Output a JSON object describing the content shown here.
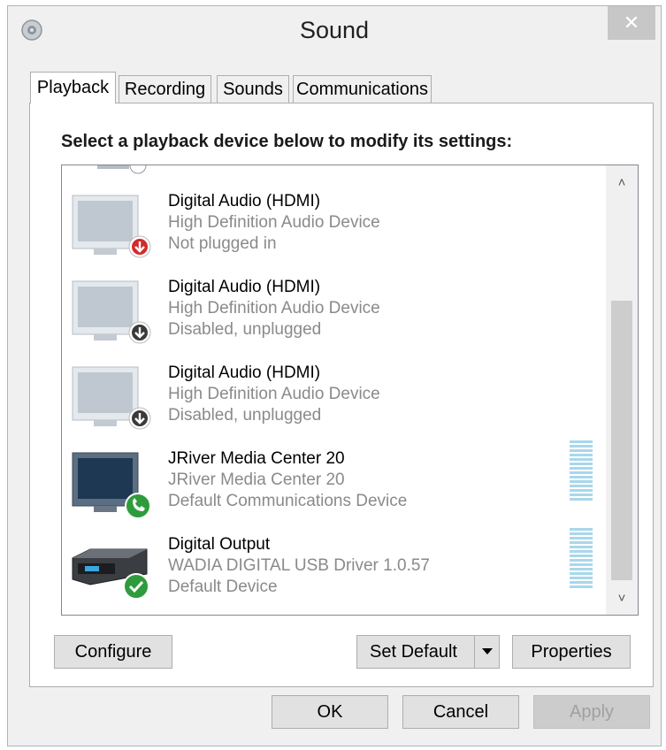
{
  "window": {
    "title": "Sound",
    "close_glyph": "✕",
    "icon": "speaker-icon"
  },
  "tabs": [
    {
      "label": "Playback",
      "active": true
    },
    {
      "label": "Recording",
      "active": false
    },
    {
      "label": "Sounds",
      "active": false
    },
    {
      "label": "Communications",
      "active": false
    }
  ],
  "playback": {
    "instruction": "Select a playback device below to modify its settings:",
    "devices": [
      {
        "name": "Digital Audio (HDMI)",
        "line1": "High Definition Audio Device",
        "line2": "Not plugged in",
        "icon": "monitor-icon",
        "status_icon": "red-down-arrow-icon"
      },
      {
        "name": "Digital Audio (HDMI)",
        "line1": "High Definition Audio Device",
        "line2": "Disabled, unplugged",
        "icon": "monitor-icon",
        "status_icon": "disabled-down-arrow-icon"
      },
      {
        "name": "Digital Audio (HDMI)",
        "line1": "High Definition Audio Device",
        "line2": "Disabled, unplugged",
        "icon": "monitor-icon",
        "status_icon": "disabled-down-arrow-icon"
      },
      {
        "name": "JRiver Media Center 20",
        "line1": "JRiver Media Center 20",
        "line2": "Default Communications Device",
        "icon": "monitor-icon",
        "status_icon": "phone-icon"
      },
      {
        "name": "Digital Output",
        "line1": "WADIA DIGITAL USB Driver 1.0.57",
        "line2": "Default Device",
        "icon": "audio-device-icon",
        "status_icon": "green-check-icon"
      }
    ],
    "scroll_up_glyph": "˄",
    "scroll_down_glyph": "˅"
  },
  "buttons": {
    "configure": "Configure",
    "set_default": "Set Default",
    "properties": "Properties",
    "ok": "OK",
    "cancel": "Cancel",
    "apply": "Apply"
  },
  "colors": {
    "secondary_text": "#8a8a8a",
    "level_meter": "#a9d7ec",
    "default_check": "#2e9c3c",
    "not_plugged": "#d12b2b"
  }
}
